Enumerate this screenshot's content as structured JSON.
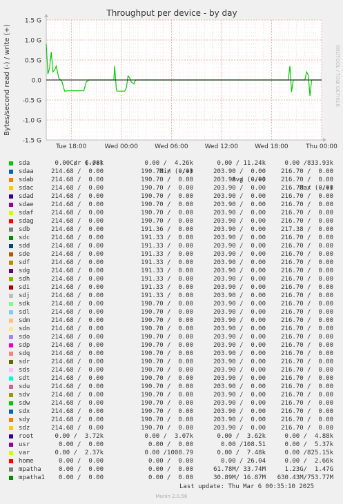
{
  "chart_data": {
    "type": "line",
    "title": "Throughput per device - by day",
    "ylabel": "Bytes/second read (-) / write (+)",
    "watermark": "RRDTOOL / TOBI OETIKER",
    "ylim": [
      -1.5,
      1.5
    ],
    "y_ticks": [
      "1.5 G",
      "1.0 G",
      "0.5 G",
      "0.0",
      "-0.5 G",
      "-1.0 G",
      "-1.5 G"
    ],
    "y_tick_values": [
      1.5,
      1.0,
      0.5,
      0.0,
      -0.5,
      -1.0,
      -1.5
    ],
    "x_range_hours": [
      -33,
      0
    ],
    "x_ticks": [
      "Tue 18:00",
      "Wed 00:00",
      "Wed 06:00",
      "Wed 12:00",
      "Wed 18:00",
      "Thu 00:00"
    ],
    "x_tick_hours": [
      -30,
      -24,
      -18,
      -12,
      -6,
      0
    ],
    "series": [
      {
        "name": "sda",
        "color": "#00cc00",
        "x": [
          -33,
          -32.8,
          -32.6,
          -32.4,
          -32.2,
          -32,
          -31.8,
          -31.5,
          -31.3,
          -31.1,
          -30.8,
          -30.4,
          -30,
          -29.5,
          -29,
          -28.5,
          -28.2,
          -27.9,
          -27.5,
          -27,
          -26.5,
          -25.5,
          -24.9,
          -24.8,
          -24.7,
          -24.6,
          -24.5,
          -24.3,
          -24.2,
          -24,
          -23.8,
          -23.6,
          -23.4,
          -23.2,
          -23.0,
          -22.8,
          -22.5,
          -22.3,
          -22.1,
          -21.9,
          -21.7,
          -20,
          -15,
          -10,
          -5,
          -4,
          -3.8,
          -3.6,
          -3.4,
          -3.2,
          -3.0,
          -2.8,
          -2.6,
          -2.4,
          -2.2,
          -2.0,
          -1.8,
          -1.6,
          -1.4,
          -1.2,
          -1.0,
          0
        ],
        "y": [
          0.9,
          0.15,
          0.3,
          0.7,
          0.2,
          0.25,
          0.35,
          0.05,
          0.0,
          -0.05,
          -0.28,
          -0.27,
          -0.27,
          -0.27,
          -0.27,
          -0.27,
          -0.05,
          0.0,
          0.0,
          0.0,
          0.0,
          0.0,
          0.0,
          0.35,
          0.05,
          -0.25,
          -0.28,
          -0.28,
          -0.28,
          -0.28,
          -0.28,
          -0.28,
          -0.2,
          0.1,
          0.05,
          -0.05,
          -0.1,
          0.0,
          0.0,
          0.0,
          0.0,
          0.0,
          0.0,
          0.0,
          0.0,
          0.0,
          0.35,
          -0.3,
          0.0,
          0.0,
          0.0,
          0.0,
          0.0,
          0.0,
          0.0,
          0.0,
          0.2,
          0.12,
          -0.4,
          0.0,
          0.0,
          0.0
        ]
      }
    ],
    "legend_header": {
      "cur": "Cur (-/+)",
      "min": "Min (-/+)",
      "avg": "Avg (-/+)",
      "max": "Max (-/+)"
    },
    "legend": [
      {
        "name": "sda",
        "color": "#00cc00",
        "cur": "0.00 /  6.08k",
        "min": "0.00 /  4.26k",
        "avg": "0.00 / 11.24k",
        "max": "0.00 /833.93k"
      },
      {
        "name": "sdaa",
        "color": "#0066b3",
        "cur": "214.68 /  0.00",
        "min": "190.70 /  0.00",
        "avg": "203.90 /  0.00",
        "max": "216.70 /  0.00"
      },
      {
        "name": "sdab",
        "color": "#ff8000",
        "cur": "214.68 /  0.00",
        "min": "190.70 /  0.00",
        "avg": "203.90 /  0.00",
        "max": "216.70 /  0.00"
      },
      {
        "name": "sdac",
        "color": "#ffcc00",
        "cur": "214.68 /  0.00",
        "min": "190.70 /  0.00",
        "avg": "203.90 /  0.00",
        "max": "216.70 /  0.00"
      },
      {
        "name": "sdad",
        "color": "#330099",
        "cur": "214.68 /  0.00",
        "min": "190.70 /  0.00",
        "avg": "203.90 /  0.00",
        "max": "216.70 /  0.00"
      },
      {
        "name": "sdae",
        "color": "#990099",
        "cur": "214.68 /  0.00",
        "min": "190.70 /  0.00",
        "avg": "203.90 /  0.00",
        "max": "216.70 /  0.00"
      },
      {
        "name": "sdaf",
        "color": "#ccff00",
        "cur": "214.68 /  0.00",
        "min": "190.70 /  0.00",
        "avg": "203.90 /  0.00",
        "max": "216.70 /  0.00"
      },
      {
        "name": "sdag",
        "color": "#ff0000",
        "cur": "214.68 /  0.00",
        "min": "190.70 /  0.00",
        "avg": "203.90 /  0.00",
        "max": "216.70 /  0.00"
      },
      {
        "name": "sdb",
        "color": "#808080",
        "cur": "214.68 /  0.00",
        "min": "191.36 /  0.00",
        "avg": "203.90 /  0.00",
        "max": "217.38 /  0.00"
      },
      {
        "name": "sdc",
        "color": "#008f00",
        "cur": "214.68 /  0.00",
        "min": "191.33 /  0.00",
        "avg": "203.90 /  0.00",
        "max": "216.70 /  0.00"
      },
      {
        "name": "sdd",
        "color": "#00487d",
        "cur": "214.68 /  0.00",
        "min": "191.33 /  0.00",
        "avg": "203.90 /  0.00",
        "max": "216.70 /  0.00"
      },
      {
        "name": "sde",
        "color": "#b35a00",
        "cur": "214.68 /  0.00",
        "min": "191.33 /  0.00",
        "avg": "203.90 /  0.00",
        "max": "216.70 /  0.00"
      },
      {
        "name": "sdf",
        "color": "#b38f00",
        "cur": "214.68 /  0.00",
        "min": "191.33 /  0.00",
        "avg": "203.90 /  0.00",
        "max": "216.70 /  0.00"
      },
      {
        "name": "sdg",
        "color": "#6b006b",
        "cur": "214.68 /  0.00",
        "min": "191.33 /  0.00",
        "avg": "203.90 /  0.00",
        "max": "216.70 /  0.00"
      },
      {
        "name": "sdh",
        "color": "#8fb300",
        "cur": "214.68 /  0.00",
        "min": "191.33 /  0.00",
        "avg": "203.90 /  0.00",
        "max": "216.70 /  0.00"
      },
      {
        "name": "sdi",
        "color": "#b30000",
        "cur": "214.68 /  0.00",
        "min": "191.33 /  0.00",
        "avg": "203.90 /  0.00",
        "max": "216.70 /  0.00"
      },
      {
        "name": "sdj",
        "color": "#bebebe",
        "cur": "214.68 /  0.00",
        "min": "191.33 /  0.00",
        "avg": "203.90 /  0.00",
        "max": "216.70 /  0.00"
      },
      {
        "name": "sdk",
        "color": "#80ff80",
        "cur": "214.68 /  0.00",
        "min": "190.70 /  0.00",
        "avg": "203.90 /  0.00",
        "max": "216.70 /  0.00"
      },
      {
        "name": "sdl",
        "color": "#80c9ff",
        "cur": "214.68 /  0.00",
        "min": "190.70 /  0.00",
        "avg": "203.90 /  0.00",
        "max": "216.70 /  0.00"
      },
      {
        "name": "sdm",
        "color": "#ffc080",
        "cur": "214.68 /  0.00",
        "min": "190.70 /  0.00",
        "avg": "203.90 /  0.00",
        "max": "216.70 /  0.00"
      },
      {
        "name": "sdn",
        "color": "#ffe680",
        "cur": "214.68 /  0.00",
        "min": "190.70 /  0.00",
        "avg": "203.90 /  0.00",
        "max": "216.70 /  0.00"
      },
      {
        "name": "sdo",
        "color": "#aa80ff",
        "cur": "214.68 /  0.00",
        "min": "190.70 /  0.00",
        "avg": "203.90 /  0.00",
        "max": "216.70 /  0.00"
      },
      {
        "name": "sdp",
        "color": "#ee00cc",
        "cur": "214.68 /  0.00",
        "min": "190.70 /  0.00",
        "avg": "203.90 /  0.00",
        "max": "216.70 /  0.00"
      },
      {
        "name": "sdq",
        "color": "#ff8080",
        "cur": "214.68 /  0.00",
        "min": "190.70 /  0.00",
        "avg": "203.90 /  0.00",
        "max": "216.70 /  0.00"
      },
      {
        "name": "sdr",
        "color": "#666600",
        "cur": "214.68 /  0.00",
        "min": "190.70 /  0.00",
        "avg": "203.90 /  0.00",
        "max": "216.70 /  0.00"
      },
      {
        "name": "sds",
        "color": "#ffbfff",
        "cur": "214.68 /  0.00",
        "min": "190.70 /  0.00",
        "avg": "203.90 /  0.00",
        "max": "216.70 /  0.00"
      },
      {
        "name": "sdt",
        "color": "#00ffcc",
        "cur": "214.68 /  0.00",
        "min": "190.70 /  0.00",
        "avg": "203.90 /  0.00",
        "max": "216.70 /  0.00"
      },
      {
        "name": "sdu",
        "color": "#cc6699",
        "cur": "214.68 /  0.00",
        "min": "190.70 /  0.00",
        "avg": "203.90 /  0.00",
        "max": "216.70 /  0.00"
      },
      {
        "name": "sdv",
        "color": "#999900",
        "cur": "214.68 /  0.00",
        "min": "190.70 /  0.00",
        "avg": "203.90 /  0.00",
        "max": "216.70 /  0.00"
      },
      {
        "name": "sdw",
        "color": "#00cc00",
        "cur": "214.68 /  0.00",
        "min": "190.70 /  0.00",
        "avg": "203.90 /  0.00",
        "max": "216.70 /  0.00"
      },
      {
        "name": "sdx",
        "color": "#0066b3",
        "cur": "214.68 /  0.00",
        "min": "190.70 /  0.00",
        "avg": "203.90 /  0.00",
        "max": "216.70 /  0.00"
      },
      {
        "name": "sdy",
        "color": "#ff8000",
        "cur": "214.68 /  0.00",
        "min": "190.70 /  0.00",
        "avg": "203.90 /  0.00",
        "max": "216.70 /  0.00"
      },
      {
        "name": "sdz",
        "color": "#ffcc00",
        "cur": "214.68 /  0.00",
        "min": "190.70 /  0.00",
        "avg": "203.90 /  0.00",
        "max": "216.70 /  0.00"
      },
      {
        "name": "root",
        "color": "#330099",
        "cur": "0.00 /  3.72k",
        "min": "0.00 /  3.07k",
        "avg": "0.00 /  3.62k",
        "max": "0.00 /  4.88k"
      },
      {
        "name": "usr",
        "color": "#990099",
        "cur": "0.00 /  0.00",
        "min": "0.00 /  0.00",
        "avg": "0.00 /108.51",
        "max": "0.00 /  5.37k"
      },
      {
        "name": "var",
        "color": "#ccff00",
        "cur": "0.00 /  2.37k",
        "min": "0.00 /1008.79",
        "avg": "0.00 /  7.48k",
        "max": "0.00 /825.15k"
      },
      {
        "name": "home",
        "color": "#ff0000",
        "cur": "0.00 /  0.00",
        "min": "0.00 /  0.00",
        "avg": "0.00 / 26.04",
        "max": "0.00 /  2.66k"
      },
      {
        "name": "mpatha",
        "color": "#808080",
        "cur": "0.00 /  0.00",
        "min": "0.00 /  0.00",
        "avg": "61.78M/ 33.74M",
        "max": "1.23G/  1.47G"
      },
      {
        "name": "mpatha1",
        "color": "#008f00",
        "cur": "0.00 /  0.00",
        "min": "0.00 /  0.00",
        "avg": "30.89M/ 16.87M",
        "max": "630.43M/753.77M"
      }
    ],
    "last_update": "Last update: Thu Mar  6 00:35:10 2025",
    "footer": "Munin 2.0.56"
  }
}
